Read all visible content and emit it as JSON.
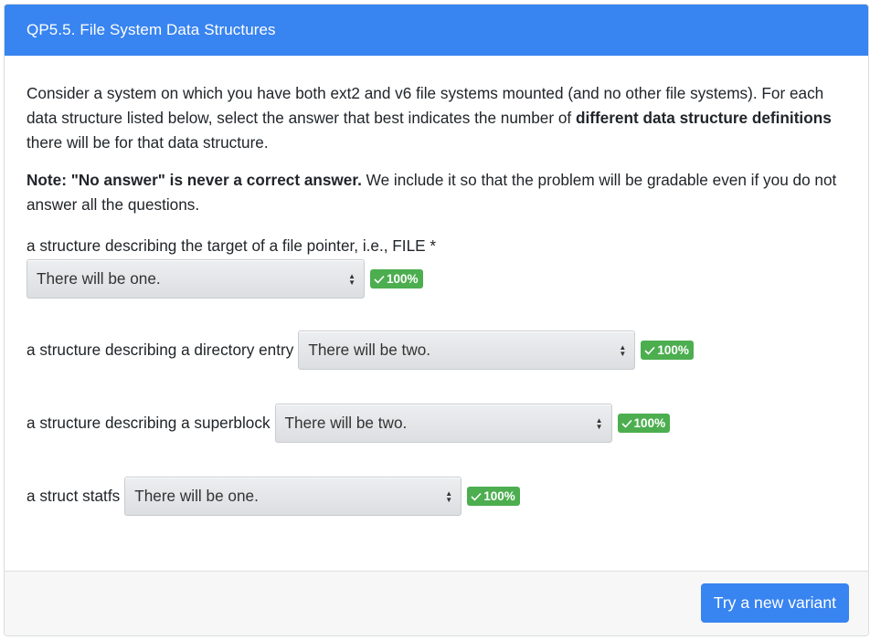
{
  "header": {
    "title": "QP5.5. File System Data Structures"
  },
  "intro": {
    "p1_a": "Consider a system on which you have both ext2 and v6 file systems mounted (and no other file systems). For each data structure listed below, select the answer that best indicates the number of ",
    "p1_bold": "different data structure definitions",
    "p1_b": " there will be for that data structure.",
    "p2_bold": "Note: \"No answer\" is never a correct answer.",
    "p2_rest": " We include it so that the problem will be gradable even if you do not answer all the questions."
  },
  "questions": [
    {
      "label": "a structure describing the target of a file pointer, i.e., FILE *",
      "selected": "There will be one.",
      "score": "100%"
    },
    {
      "label": "a structure describing a directory entry",
      "selected": "There will be two.",
      "score": "100%"
    },
    {
      "label": "a structure describing a superblock",
      "selected": "There will be two.",
      "score": "100%"
    },
    {
      "label": "a struct statfs",
      "selected": "There will be one.",
      "score": "100%"
    }
  ],
  "footer": {
    "button_label": "Try a new variant"
  },
  "colors": {
    "primary": "#3884f0",
    "success": "#4cae4f"
  },
  "icons": {
    "badge": "check-icon",
    "select": "select-arrows-icon"
  }
}
